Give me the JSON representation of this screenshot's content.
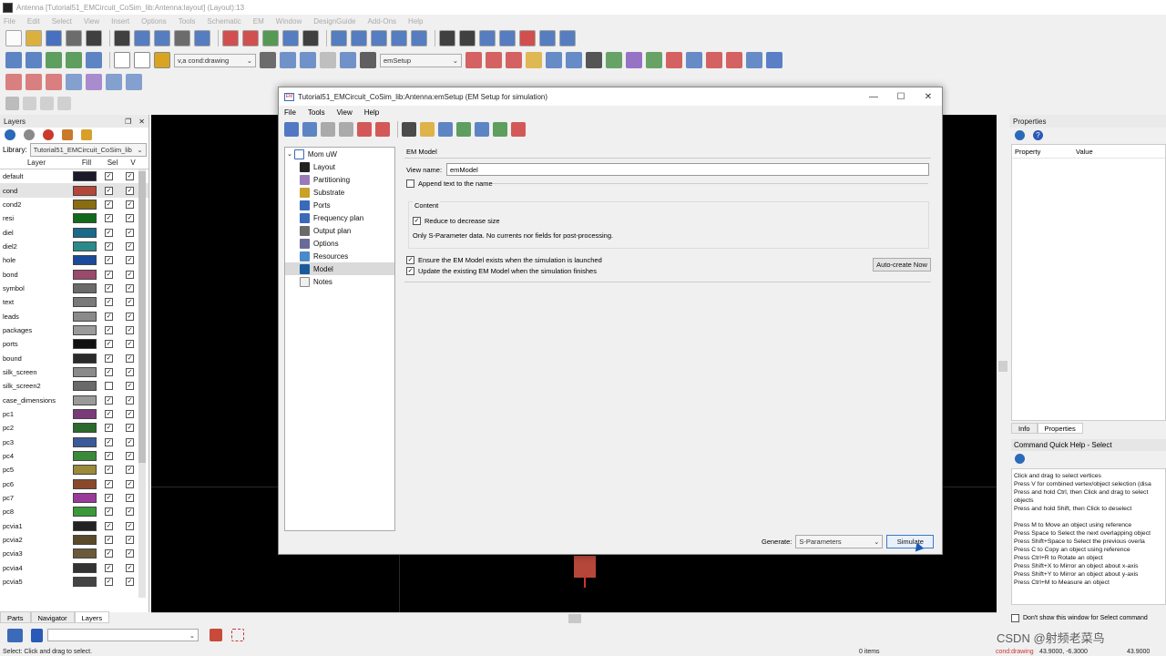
{
  "window": {
    "title": "Antenna [Tutorial51_EMCircuit_CoSim_lib:Antenna:layout] (Layout):13"
  },
  "menu": [
    "File",
    "Edit",
    "Select",
    "View",
    "Insert",
    "Options",
    "Tools",
    "Schematic",
    "EM",
    "Window",
    "DesignGuide",
    "Add-Ons",
    "Help"
  ],
  "toolbar": {
    "layer_combo": "v,a cond:drawing",
    "em_combo": "emSetup"
  },
  "layers_panel": {
    "title": "Layers",
    "library_label": "Library:",
    "library_value": "Tutorial51_EMCircuit_CoSim_lib",
    "columns": [
      "Layer",
      "Fill",
      "Sel",
      "V"
    ],
    "rows": [
      {
        "name": "default",
        "color": "#1a1a2a",
        "sel": true
      },
      {
        "name": "cond",
        "color": "#b5473a",
        "sel": true
      },
      {
        "name": "cond2",
        "color": "#8a6d10",
        "sel": true
      },
      {
        "name": "resi",
        "color": "#0f6b1a",
        "sel": true
      },
      {
        "name": "diel",
        "color": "#1a6a8a",
        "sel": true
      },
      {
        "name": "diel2",
        "color": "#2a8a8a",
        "sel": true
      },
      {
        "name": "hole",
        "color": "#1a4a9a",
        "sel": true
      },
      {
        "name": "bond",
        "color": "#9a4a6a",
        "sel": true
      },
      {
        "name": "symbol",
        "color": "#6a6a6a",
        "sel": true
      },
      {
        "name": "text",
        "color": "#7a7a7a",
        "sel": true
      },
      {
        "name": "leads",
        "color": "#8a8a8a",
        "sel": true
      },
      {
        "name": "packages",
        "color": "#9a9a9a",
        "sel": true
      },
      {
        "name": "ports",
        "color": "#111111",
        "sel": true
      },
      {
        "name": "bound",
        "color": "#2a2a2a",
        "sel": true
      },
      {
        "name": "silk_screen",
        "color": "#8a8a8a",
        "sel": true
      },
      {
        "name": "silk_screen2",
        "color": "#6a6a6a",
        "sel": false
      },
      {
        "name": "case_dimensions",
        "color": "#9a9a9a",
        "sel": true
      },
      {
        "name": "pc1",
        "color": "#7a3a7a",
        "sel": true
      },
      {
        "name": "pc2",
        "color": "#2a6a2a",
        "sel": true
      },
      {
        "name": "pc3",
        "color": "#3a5a9a",
        "sel": true
      },
      {
        "name": "pc4",
        "color": "#3a8a3a",
        "sel": true
      },
      {
        "name": "pc5",
        "color": "#9a8a3a",
        "sel": true
      },
      {
        "name": "pc6",
        "color": "#8a4a2a",
        "sel": true
      },
      {
        "name": "pc7",
        "color": "#9a3a9a",
        "sel": true
      },
      {
        "name": "pc8",
        "color": "#3a9a3a",
        "sel": true
      },
      {
        "name": "pcvia1",
        "color": "#222222",
        "sel": true
      },
      {
        "name": "pcvia2",
        "color": "#5a4a2a",
        "sel": true
      },
      {
        "name": "pcvia3",
        "color": "#6a5a3a",
        "sel": true
      },
      {
        "name": "pcvia4",
        "color": "#333333",
        "sel": true
      },
      {
        "name": "pcvia5",
        "color": "#444444",
        "sel": true
      }
    ],
    "tabs": [
      "Parts",
      "Navigator",
      "Layers"
    ]
  },
  "dialog": {
    "title": "Tutorial51_EMCircuit_CoSim_lib:Antenna:emSetup (EM Setup for simulation)",
    "menu": [
      "File",
      "Tools",
      "View",
      "Help"
    ],
    "tree_root": "Mom uW",
    "tree_items": [
      "Layout",
      "Partitioning",
      "Substrate",
      "Ports",
      "Frequency plan",
      "Output plan",
      "Options",
      "Resources",
      "Model",
      "Notes"
    ],
    "tree_icon_colors": [
      "#222",
      "#9a7ab8",
      "#c9a227",
      "#3a6ab8",
      "#3a6ab8",
      "#6a6a6a",
      "#6a6a9a",
      "#4a8ac8",
      "#1a5a9a",
      "#f0f0f0"
    ],
    "selected_index": 8,
    "section_title": "EM Model",
    "view_name_label": "View name:",
    "view_name_value": "emModel",
    "append_label": "Append text to the name",
    "content_title": "Content",
    "reduce_label": "Reduce to decrease size",
    "info_text": "Only S-Parameter data. No currents nor fields for post-processing.",
    "ensure_label": "Ensure the EM Model exists when the simulation is launched",
    "update_label": "Update the existing EM Model when the simulation finishes",
    "autocreate_label": "Auto-create Now",
    "generate_label": "Generate:",
    "generate_value": "S-Parameters",
    "simulate_label": "Simulate"
  },
  "properties_panel": {
    "title": "Properties",
    "col_property": "Property",
    "col_value": "Value",
    "tabs": [
      "Info",
      "Properties"
    ],
    "help_title": "Command Quick Help - Select",
    "help_lines": [
      "Click and drag to select vertices",
      "Press V for combined vertex/object selection (disa",
      "Press and hold Ctrl, then Click and drag to select",
      "objects",
      "Press and hold Shift, then Click to deselect",
      "",
      "Press M to Move an object using reference",
      "Press Space to Select the next overlapping object",
      "Press Shift+Space to Select the previous overla",
      "Press C to Copy an object using reference",
      "Press Ctrl+R to Rotate an object",
      "Press Shift+X to Mirror an object about x-axis",
      "Press Shift+Y to Mirror an object about y-axis",
      "Press Ctrl+M to Measure an object"
    ],
    "dont_show_label": "Don't show this window for Select command"
  },
  "status": {
    "left": "Select: Click and drag to select.",
    "items": "0 items",
    "layer": "cond:drawing",
    "coord1": "43.9000, -6.3000",
    "coord2": "43.9000"
  },
  "watermark": "CSDN @射频老菜鸟"
}
